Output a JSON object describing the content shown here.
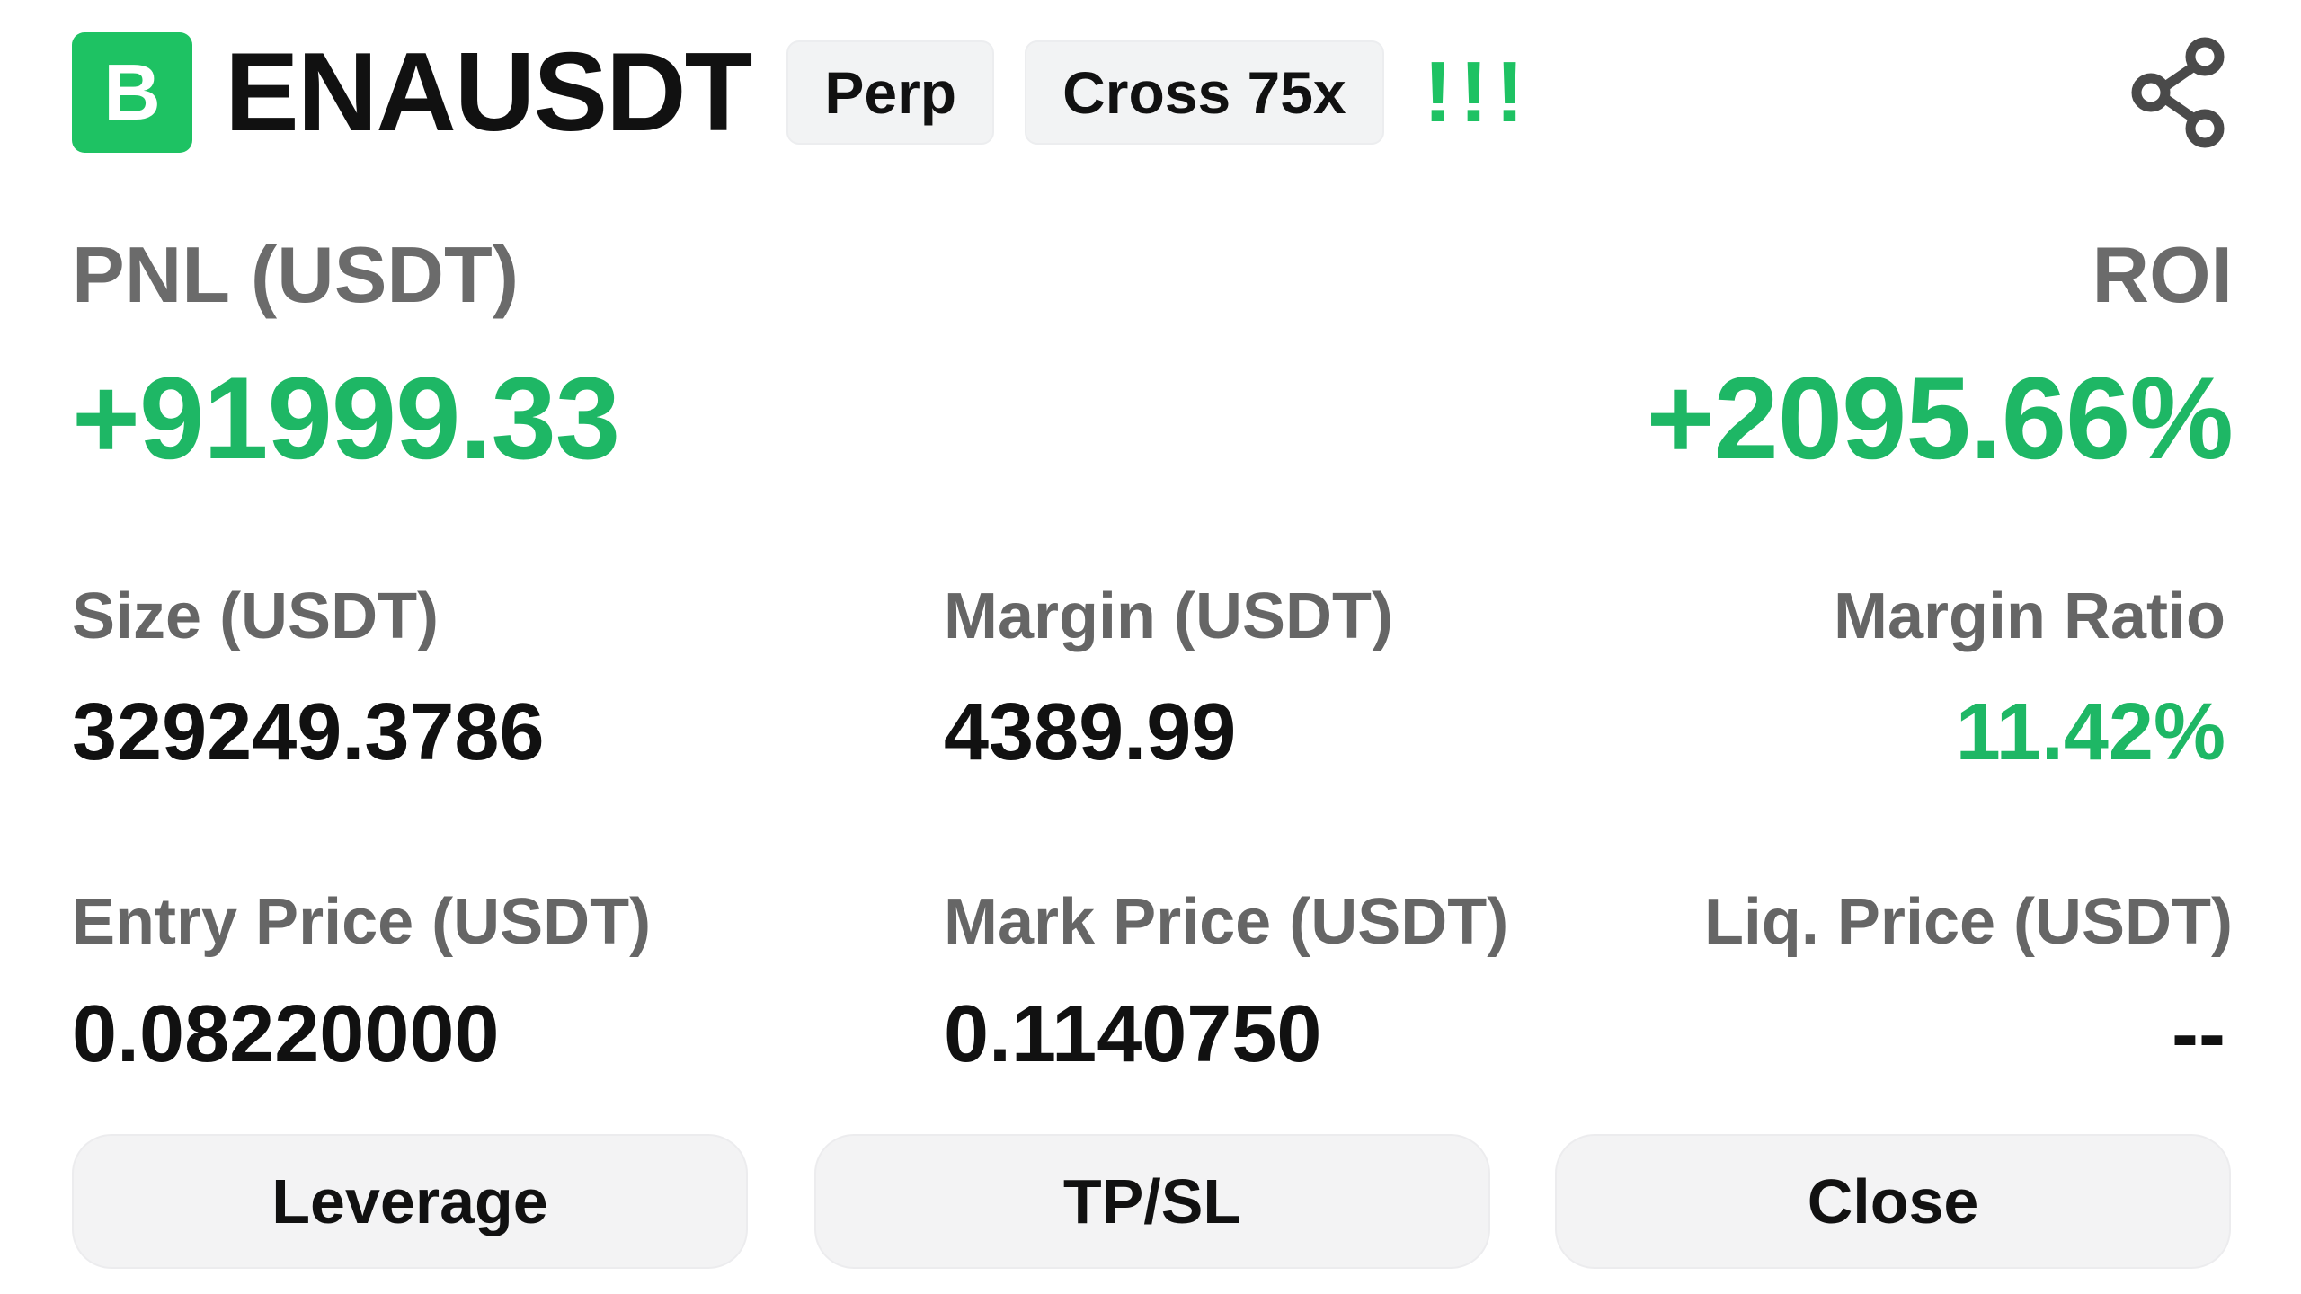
{
  "header": {
    "exchange_badge": "B",
    "symbol": "ENAUSDT",
    "contract_type": "Perp",
    "margin_mode": "Cross 75x",
    "alert_mark": "!!!",
    "share_icon": "share-icon"
  },
  "pnl": {
    "label": "PNL (USDT)",
    "value": "+91999.33"
  },
  "roi": {
    "label": "ROI",
    "value": "+2095.66%"
  },
  "stats": {
    "size": {
      "label": "Size (USDT)",
      "value": "329249.3786"
    },
    "margin": {
      "label": "Margin (USDT)",
      "value": "4389.99"
    },
    "margin_ratio": {
      "label": "Margin Ratio",
      "value": "11.42%"
    },
    "entry_price": {
      "label": "Entry Price (USDT)",
      "value": "0.08220000"
    },
    "mark_price": {
      "label": "Mark Price (USDT)",
      "value": "0.1140750"
    },
    "liq_price": {
      "label": "Liq. Price (USDT)",
      "value": "--"
    }
  },
  "actions": {
    "leverage": "Leverage",
    "tpsl": "TP/SL",
    "close": "Close"
  },
  "colors": {
    "accent_green": "#1eb765",
    "badge_green": "#1ec263",
    "label_gray": "#666666",
    "text_dark": "#111111",
    "chip_bg": "#f2f3f4"
  }
}
